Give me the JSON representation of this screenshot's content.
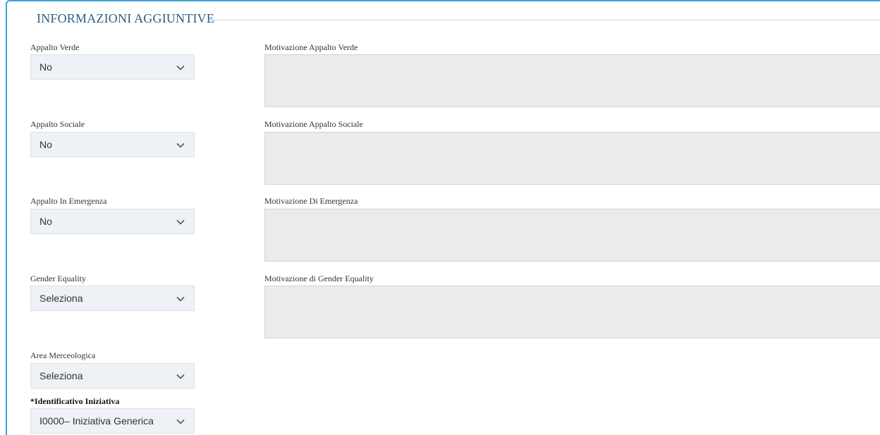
{
  "section": {
    "title": "INFORMAZIONI AGGIUNTIVE"
  },
  "fields": {
    "appalto_verde": {
      "label": "Appalto Verde",
      "value": "No",
      "motivazione_label": "Motivazione Appalto Verde",
      "motivazione_value": ""
    },
    "appalto_sociale": {
      "label": "Appalto Sociale",
      "value": "No",
      "motivazione_label": "Motivazione Appalto Sociale",
      "motivazione_value": ""
    },
    "appalto_emergenza": {
      "label": "Appalto In Emergenza",
      "value": "No",
      "motivazione_label": "Motivazione Di Emergenza",
      "motivazione_value": ""
    },
    "gender_equality": {
      "label": "Gender Equality",
      "value": "Seleziona",
      "motivazione_label": "Motivazione di Gender Equality",
      "motivazione_value": ""
    },
    "area_merceologica": {
      "label": "Area Merceologica",
      "value": "Seleziona"
    },
    "identificativo_iniziativa": {
      "label": "*Identificativo Iniziativa",
      "value": "I0000– Iniziativa Generica"
    }
  },
  "icons": {
    "dropdown": "chevron-down-icon"
  },
  "colors": {
    "frame_border": "#3aa3d8",
    "legend_text": "#2b5f86",
    "select_bg": "#eef2f6",
    "textarea_bg": "#ebebeb"
  }
}
